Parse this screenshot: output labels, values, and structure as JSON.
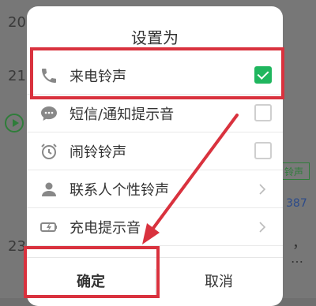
{
  "background": {
    "numbers": [
      "20",
      "21",
      "23"
    ],
    "right_tag": "铃声",
    "right_number": "387",
    "right_punct": "，",
    "right_ellipsis": "…"
  },
  "dialog": {
    "title": "设置为",
    "options": [
      {
        "label": "来电铃声",
        "icon": "phone-icon",
        "control": "checkbox",
        "checked": true
      },
      {
        "label": "短信/通知提示音",
        "icon": "message-icon",
        "control": "checkbox",
        "checked": false
      },
      {
        "label": "闹铃铃声",
        "icon": "alarm-clock-icon",
        "control": "checkbox",
        "checked": false
      },
      {
        "label": "联系人个性铃声",
        "icon": "contact-icon",
        "control": "chevron"
      },
      {
        "label": "充电提示音",
        "icon": "battery-charging-icon",
        "control": "chevron"
      }
    ],
    "ok_label": "确定",
    "cancel_label": "取消"
  },
  "colors": {
    "highlight": "#d9323e",
    "check_green": "#1fb65e"
  }
}
